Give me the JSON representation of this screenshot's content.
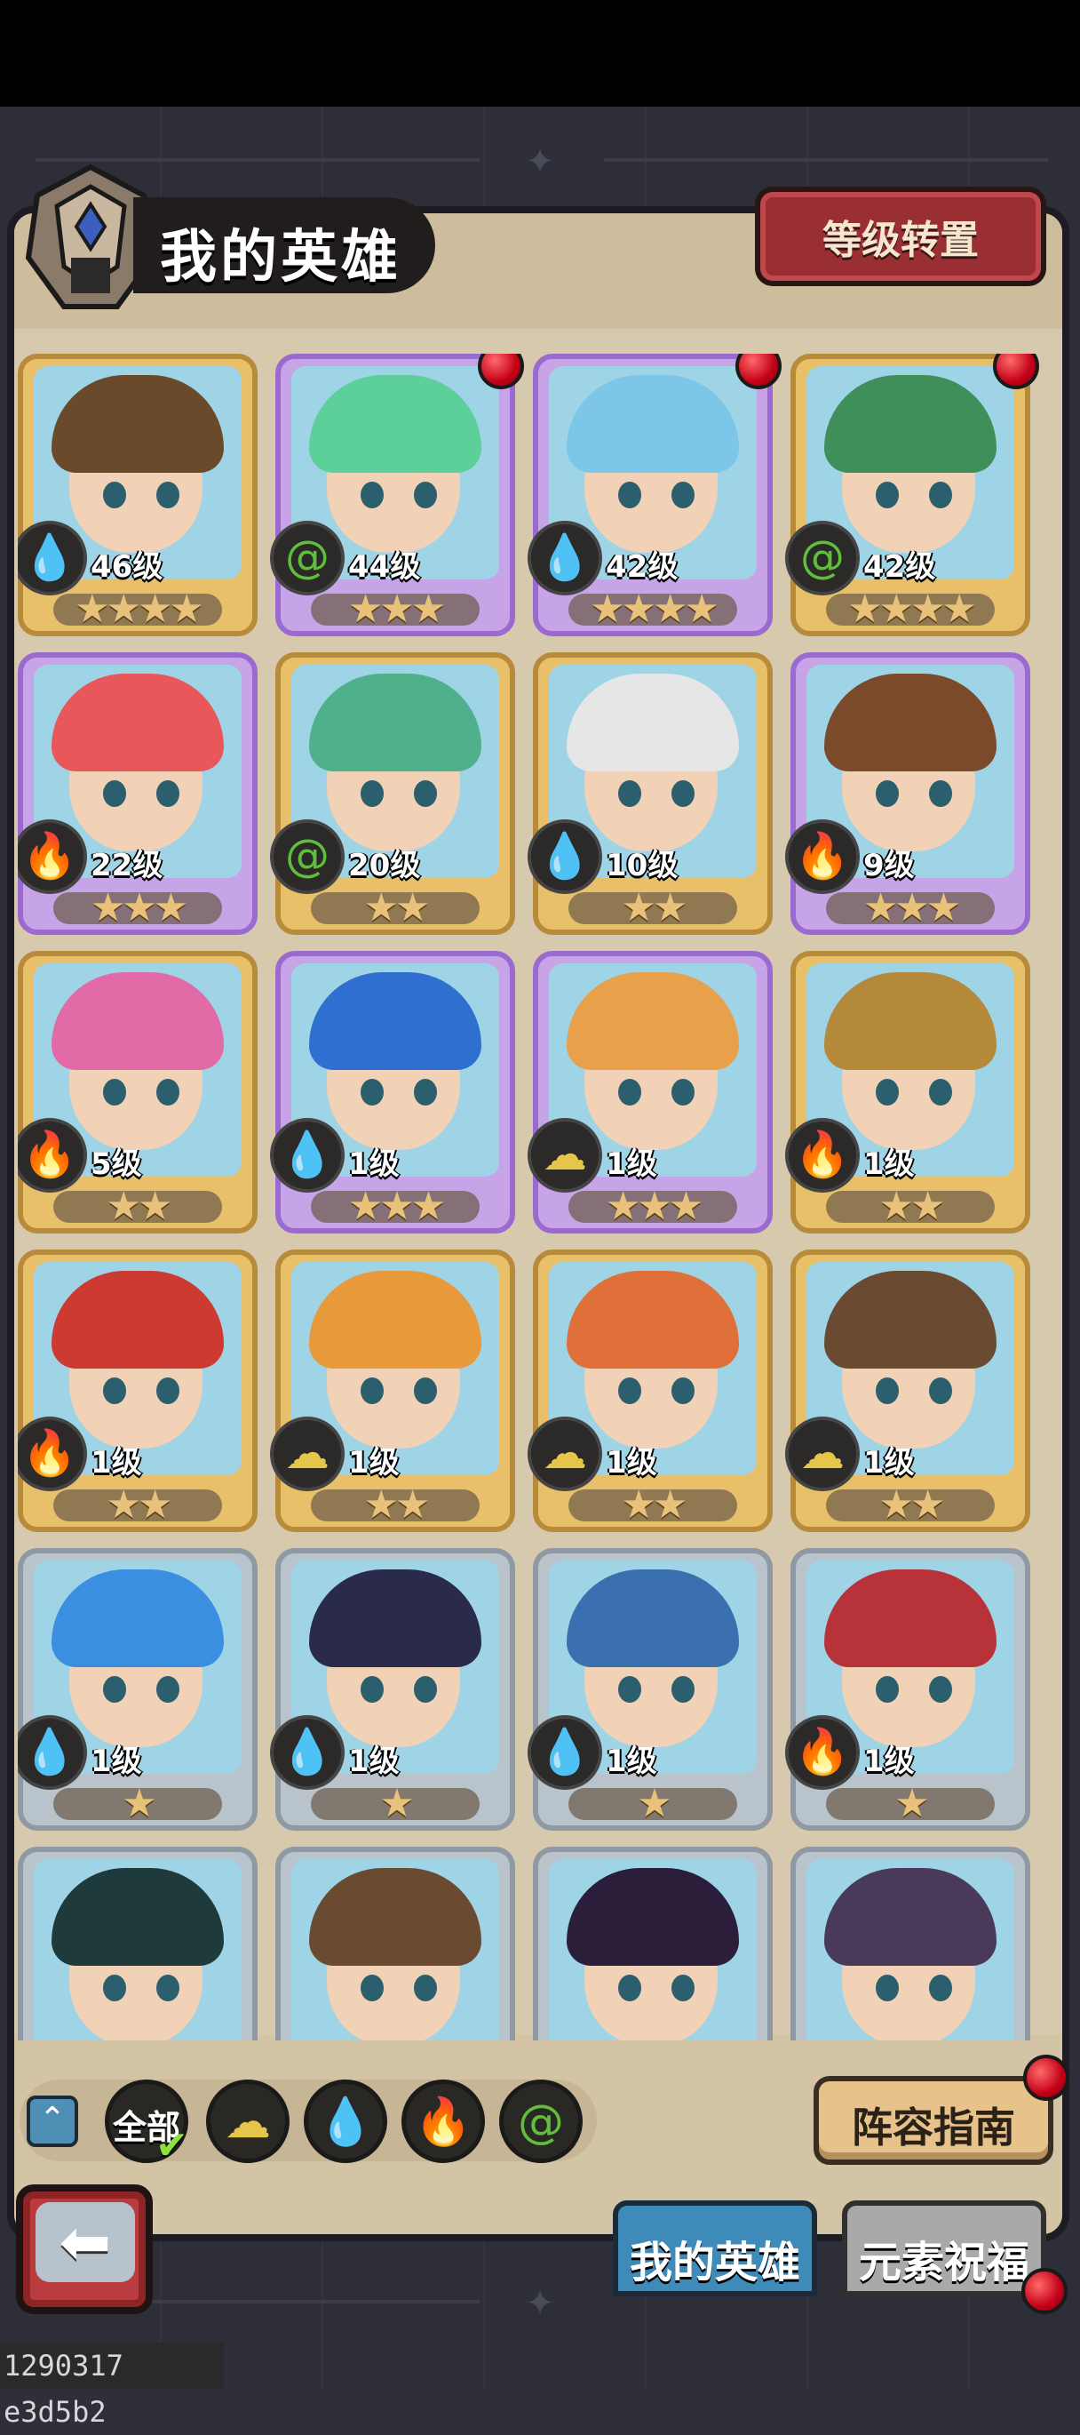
{
  "header": {
    "title": "我的英雄",
    "level_transfer_label": "等级转置"
  },
  "heroes": [
    {
      "level": "46级",
      "stars": "★★★★",
      "element": "water",
      "rarity": "gold",
      "badge": false
    },
    {
      "level": "44级",
      "stars": "★★★",
      "element": "wind",
      "rarity": "purple",
      "badge": true
    },
    {
      "level": "42级",
      "stars": "★★★★",
      "element": "water",
      "rarity": "purple",
      "badge": true
    },
    {
      "level": "42级",
      "stars": "★★★★",
      "element": "wind",
      "rarity": "gold",
      "badge": true
    },
    {
      "level": "22级",
      "stars": "★★★",
      "element": "fire",
      "rarity": "purple",
      "badge": false
    },
    {
      "level": "20级",
      "stars": "★★",
      "element": "wind",
      "rarity": "gold",
      "badge": false
    },
    {
      "level": "10级",
      "stars": "★★",
      "element": "water",
      "rarity": "gold",
      "badge": false
    },
    {
      "level": "9级",
      "stars": "★★★",
      "element": "fire",
      "rarity": "purple",
      "badge": false
    },
    {
      "level": "5级",
      "stars": "★★",
      "element": "fire",
      "rarity": "gold",
      "badge": false
    },
    {
      "level": "1级",
      "stars": "★★★",
      "element": "water",
      "rarity": "purple",
      "badge": false
    },
    {
      "level": "1级",
      "stars": "★★★",
      "element": "earth",
      "rarity": "purple",
      "badge": false
    },
    {
      "level": "1级",
      "stars": "★★",
      "element": "fire",
      "rarity": "gold",
      "badge": false
    },
    {
      "level": "1级",
      "stars": "★★",
      "element": "fire",
      "rarity": "gold",
      "badge": false
    },
    {
      "level": "1级",
      "stars": "★★",
      "element": "earth",
      "rarity": "gold",
      "badge": false
    },
    {
      "level": "1级",
      "stars": "★★",
      "element": "earth",
      "rarity": "gold",
      "badge": false
    },
    {
      "level": "1级",
      "stars": "★★",
      "element": "earth",
      "rarity": "gold",
      "badge": false
    },
    {
      "level": "1级",
      "stars": "★",
      "element": "water",
      "rarity": "silver",
      "badge": false
    },
    {
      "level": "1级",
      "stars": "★",
      "element": "water",
      "rarity": "silver",
      "badge": false
    },
    {
      "level": "1级",
      "stars": "★",
      "element": "water",
      "rarity": "silver",
      "badge": false
    },
    {
      "level": "1级",
      "stars": "★",
      "element": "fire",
      "rarity": "silver",
      "badge": false
    },
    {
      "level": "",
      "stars": "",
      "element": "",
      "rarity": "silver",
      "badge": false
    },
    {
      "level": "",
      "stars": "",
      "element": "",
      "rarity": "silver",
      "badge": false
    },
    {
      "level": "",
      "stars": "",
      "element": "",
      "rarity": "silver",
      "badge": false
    },
    {
      "level": "",
      "stars": "",
      "element": "",
      "rarity": "silver",
      "badge": false
    }
  ],
  "filters": {
    "all_label": "全部",
    "items": [
      "all",
      "earth",
      "water",
      "fire",
      "wind"
    ]
  },
  "guide_label": "阵容指南",
  "tabs": {
    "heroes": "我的英雄",
    "blessing": "元素祝福"
  },
  "watermark": "1290317 e3d5b2",
  "colors": {
    "water": "#4aa7e8",
    "wind": "#5fbf3a",
    "fire": "#ef5a56",
    "earth": "#e6c64a",
    "badge": "#d0101e"
  }
}
